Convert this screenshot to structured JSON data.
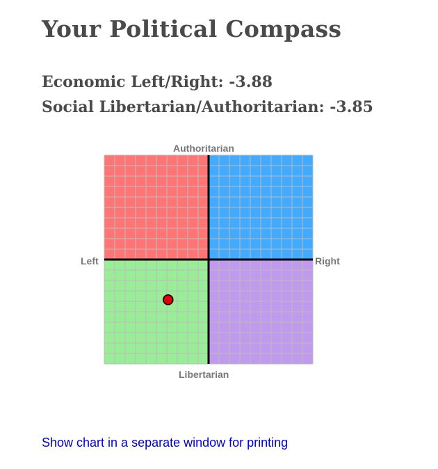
{
  "page": {
    "title": "Your Political Compass",
    "economic_line": "Economic Left/Right: -3.88",
    "social_line": "Social Libertarian/Authoritarian: -3.85",
    "print_link": "Show chart in a separate window for printing"
  },
  "compass": {
    "label_top": "Authoritarian",
    "label_bottom": "Libertarian",
    "label_left": "Left",
    "label_right": "Right"
  },
  "colors": {
    "authoritarian_left": "#ff7575",
    "authoritarian_right": "#42aaff",
    "libertarian_left": "#9aed97",
    "libertarian_right": "#c09aec",
    "grid_line": "#bbbbbb",
    "axis": "#000000",
    "marker": "#e00000"
  },
  "chart_data": {
    "type": "scatter",
    "title": "",
    "xlabel": "",
    "ylabel": "",
    "xlim": [
      -10,
      10
    ],
    "ylim": [
      -10,
      10
    ],
    "grid": true,
    "points": [
      {
        "x": -3.88,
        "y": -3.85
      }
    ]
  }
}
